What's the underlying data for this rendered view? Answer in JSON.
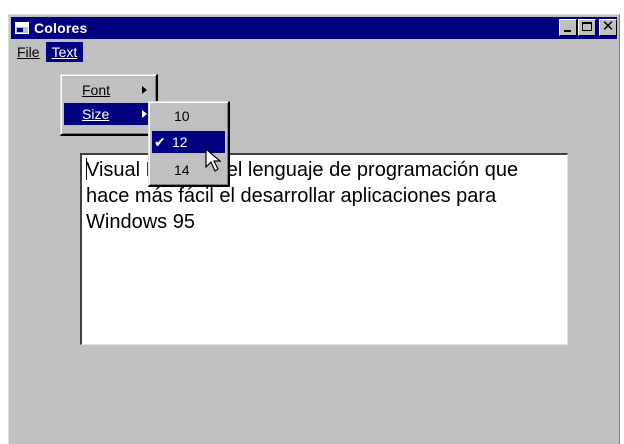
{
  "window": {
    "title": "Colores",
    "icon": "app-window-icon"
  },
  "title_buttons": {
    "minimize_icon": "minimize-icon",
    "maximize_icon": "maximize-icon",
    "close_icon": "close-icon",
    "close_glyph": "✕"
  },
  "menubar": {
    "file_label": "File",
    "text_label": "Text"
  },
  "text_menu": {
    "items": [
      {
        "label": "Font"
      },
      {
        "label": "Size"
      }
    ]
  },
  "size_menu": {
    "items": [
      {
        "label": "10"
      },
      {
        "label": "12",
        "checked": true,
        "check_glyph": "✔"
      },
      {
        "label": "14"
      }
    ]
  },
  "textbox": {
    "content": "Visual Basic es el lenguaje de programación que hace más fácil el desarrollar aplicaciones para Windows 95"
  },
  "colors": {
    "title_bar": "#000080",
    "face": "#c0c0c0",
    "highlight": "#000080"
  }
}
